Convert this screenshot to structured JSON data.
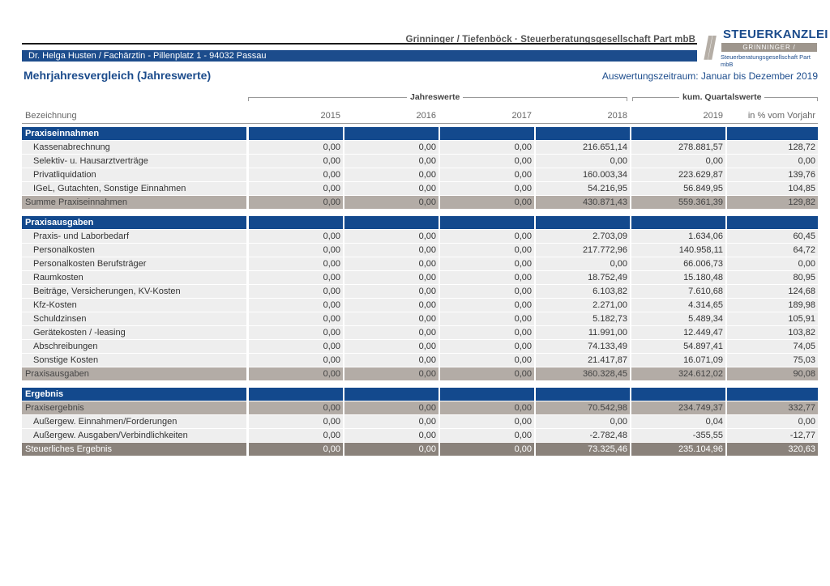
{
  "header": {
    "firm_name": "Grinninger / Tiefenböck · Steuerberatungsgesellschaft Part mbB",
    "client_line": "Dr. Helga Husten / Fachärztin  -  Pillenplatz 1  -  94032 Passau",
    "logo": {
      "slash": "//",
      "main": "STEUERKANZLEI",
      "sub": "GRINNINGER / TIEFENBÖCK",
      "tag": "Steuerberatungsgesellschaft Part mbB"
    }
  },
  "report": {
    "title": "Mehrjahresvergleich (Jahreswerte)",
    "period": "Auswertungszeitraum: Januar bis Dezember 2019"
  },
  "columns": {
    "group_jahreswerte": "Jahreswerte",
    "group_kum": "kum. Quartalswerte",
    "bezeichnung": "Bezeichnung",
    "y2015": "2015",
    "y2016": "2016",
    "y2017": "2017",
    "y2018": "2018",
    "y2019": "2019",
    "pct": "in % vom Vorjahr"
  },
  "sections": [
    {
      "title": "Praxiseinnahmen",
      "items": [
        {
          "label": "Kassenabrechnung",
          "values": [
            "0,00",
            "0,00",
            "0,00",
            "216.651,14",
            "278.881,57",
            "128,72"
          ]
        },
        {
          "label": "Selektiv- u. Hausarztverträge",
          "values": [
            "0,00",
            "0,00",
            "0,00",
            "0,00",
            "0,00",
            "0,00"
          ]
        },
        {
          "label": "Privatliquidation",
          "values": [
            "0,00",
            "0,00",
            "0,00",
            "160.003,34",
            "223.629,87",
            "139,76"
          ]
        },
        {
          "label": "IGeL, Gutachten, Sonstige Einnahmen",
          "values": [
            "0,00",
            "0,00",
            "0,00",
            "54.216,95",
            "56.849,95",
            "104,85"
          ]
        }
      ],
      "sum": {
        "label": "Summe Praxiseinnahmen",
        "values": [
          "0,00",
          "0,00",
          "0,00",
          "430.871,43",
          "559.361,39",
          "129,82"
        ]
      }
    },
    {
      "title": "Praxisausgaben",
      "items": [
        {
          "label": "Praxis- und Laborbedarf",
          "values": [
            "0,00",
            "0,00",
            "0,00",
            "2.703,09",
            "1.634,06",
            "60,45"
          ]
        },
        {
          "label": "Personalkosten",
          "values": [
            "0,00",
            "0,00",
            "0,00",
            "217.772,96",
            "140.958,11",
            "64,72"
          ]
        },
        {
          "label": "Personalkosten Berufsträger",
          "values": [
            "0,00",
            "0,00",
            "0,00",
            "0,00",
            "66.006,73",
            "0,00"
          ]
        },
        {
          "label": "Raumkosten",
          "values": [
            "0,00",
            "0,00",
            "0,00",
            "18.752,49",
            "15.180,48",
            "80,95"
          ]
        },
        {
          "label": "Beiträge, Versicherungen, KV-Kosten",
          "values": [
            "0,00",
            "0,00",
            "0,00",
            "6.103,82",
            "7.610,68",
            "124,68"
          ]
        },
        {
          "label": "Kfz-Kosten",
          "values": [
            "0,00",
            "0,00",
            "0,00",
            "2.271,00",
            "4.314,65",
            "189,98"
          ]
        },
        {
          "label": "Schuldzinsen",
          "values": [
            "0,00",
            "0,00",
            "0,00",
            "5.182,73",
            "5.489,34",
            "105,91"
          ]
        },
        {
          "label": "Gerätekosten / -leasing",
          "values": [
            "0,00",
            "0,00",
            "0,00",
            "11.991,00",
            "12.449,47",
            "103,82"
          ]
        },
        {
          "label": "Abschreibungen",
          "values": [
            "0,00",
            "0,00",
            "0,00",
            "74.133,49",
            "54.897,41",
            "74,05"
          ]
        },
        {
          "label": "Sonstige Kosten",
          "values": [
            "0,00",
            "0,00",
            "0,00",
            "21.417,87",
            "16.071,09",
            "75,03"
          ]
        }
      ],
      "sum": {
        "label": "Praxisausgaben",
        "values": [
          "0,00",
          "0,00",
          "0,00",
          "360.328,45",
          "324.612,02",
          "90,08"
        ]
      }
    },
    {
      "title": "Ergebnis",
      "lead": {
        "label": "Praxisergebnis",
        "values": [
          "0,00",
          "0,00",
          "0,00",
          "70.542,98",
          "234.749,37",
          "332,77"
        ]
      },
      "items": [
        {
          "label": "Außergew. Einnahmen/Forderungen",
          "values": [
            "0,00",
            "0,00",
            "0,00",
            "0,00",
            "0,04",
            "0,00"
          ]
        },
        {
          "label": "Außergew. Ausgaben/Verbindlichkeiten",
          "values": [
            "0,00",
            "0,00",
            "0,00",
            "-2.782,48",
            "-355,55",
            "-12,77"
          ]
        }
      ],
      "total": {
        "label": "Steuerliches Ergebnis",
        "values": [
          "0,00",
          "0,00",
          "0,00",
          "73.325,46",
          "235.104,96",
          "320,63"
        ]
      }
    }
  ]
}
